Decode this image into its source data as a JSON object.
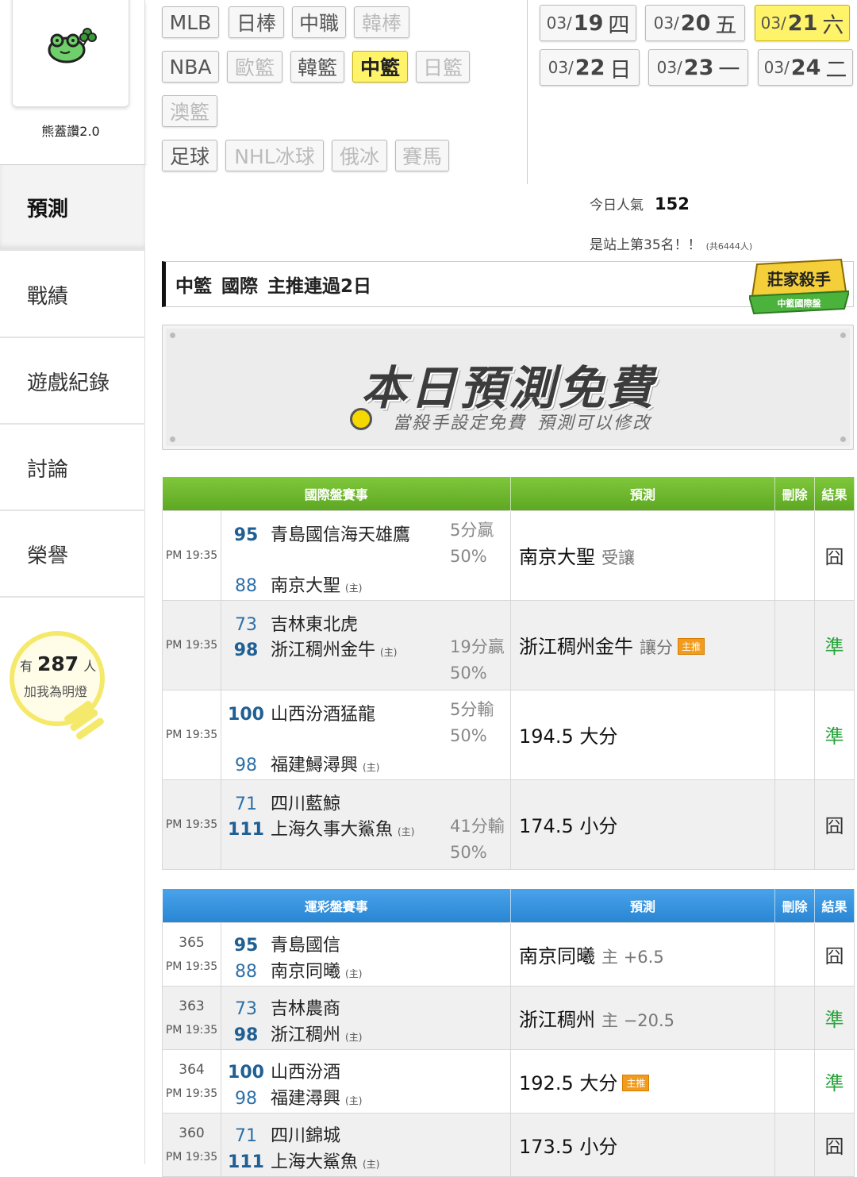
{
  "sidebar": {
    "nickname": "熊蓋讚2.0",
    "nav": [
      "預測",
      "戰績",
      "遊戲紀錄",
      "討論",
      "榮譽"
    ],
    "fans": {
      "prefix": "有",
      "count": "287",
      "suffix": "人",
      "caption": "加我為明燈"
    }
  },
  "leagues": {
    "row1": [
      "MLB",
      "日棒",
      "中職",
      "韓棒"
    ],
    "row2": [
      "NBA",
      "歐籃",
      "韓籃",
      "中籃",
      "日籃"
    ],
    "row3": [
      "澳籃"
    ],
    "row4": [
      "足球",
      "NHL冰球",
      "俄冰",
      "賽馬"
    ]
  },
  "dates": [
    {
      "md": "03/",
      "day": "19",
      "wd": "四"
    },
    {
      "md": "03/",
      "day": "20",
      "wd": "五"
    },
    {
      "md": "03/",
      "day": "21",
      "wd": "六"
    },
    {
      "md": "03/",
      "day": "22",
      "wd": "日"
    },
    {
      "md": "03/",
      "day": "23",
      "wd": "一"
    },
    {
      "md": "03/",
      "day": "24",
      "wd": "二"
    }
  ],
  "popularity": {
    "label": "今日人氣",
    "value": "152",
    "rank": "是站上第35名！！",
    "total": "(共6444人)"
  },
  "headline": {
    "league": "中籃",
    "board": "國際",
    "text": "主推連過2日"
  },
  "killer_badge": {
    "title": "莊家殺手",
    "sub": "中籃國際盤"
  },
  "banner": {
    "title": "本日預測免費",
    "sub1": "當殺手設定免費",
    "sub2": "預測可以修改"
  },
  "intl_table": {
    "headers": [
      "國際盤賽事",
      "預測",
      "刪除",
      "結果"
    ],
    "rows": [
      {
        "time": "PM 19:35",
        "away_score": "95",
        "away": "青島國信海天雄鷹",
        "home_score": "88",
        "home": "南京大聖",
        "home_tag": "(主)",
        "odds1": "5分贏",
        "odds2": "50%",
        "pick": "南京大聖",
        "pick_sub": "受讓",
        "result": "囧"
      },
      {
        "time": "PM 19:35",
        "away_score": "73",
        "away": "吉林東北虎",
        "home_score": "98",
        "home": "浙江稠州金牛",
        "home_tag": "(主)",
        "odds1": "19分贏",
        "odds2": "50%",
        "pick": "浙江稠州金牛",
        "pick_sub": "讓分",
        "pick_tag": "主推",
        "result": "準"
      },
      {
        "time": "PM 19:35",
        "away_score": "100",
        "away": "山西汾酒猛龍",
        "home_score": "98",
        "home": "福建鱘潯興",
        "home_tag": "(主)",
        "odds1": "5分輸",
        "odds2": "50%",
        "pick": "194.5 大分",
        "result": "準"
      },
      {
        "time": "PM 19:35",
        "away_score": "71",
        "away": "四川藍鯨",
        "home_score": "111",
        "home": "上海久事大鯊魚",
        "home_tag": "(主)",
        "odds1": "41分輸",
        "odds2": "50%",
        "pick": "174.5 小分",
        "result": "囧"
      }
    ]
  },
  "lottery_table": {
    "headers": [
      "運彩盤賽事",
      "預測",
      "刪除",
      "結果"
    ],
    "rows": [
      {
        "num": "365",
        "time": "PM 19:35",
        "away_score": "95",
        "away": "青島國信",
        "home_score": "88",
        "home": "南京同曦",
        "home_tag": "(主)",
        "pick": "南京同曦",
        "pick_sub": "主 +6.5",
        "result": "囧"
      },
      {
        "num": "363",
        "time": "PM 19:35",
        "away_score": "73",
        "away": "吉林農商",
        "home_score": "98",
        "home": "浙江稠州",
        "home_tag": "(主)",
        "pick": "浙江稠州",
        "pick_sub": "主 −20.5",
        "result": "準"
      },
      {
        "num": "364",
        "time": "PM 19:35",
        "away_score": "100",
        "away": "山西汾酒",
        "home_score": "98",
        "home": "福建潯興",
        "home_tag": "(主)",
        "pick": "192.5 大分",
        "pick_tag": "主推",
        "result": "準"
      },
      {
        "num": "360",
        "time": "PM 19:35",
        "away_score": "71",
        "away": "四川錦城",
        "home_score": "111",
        "home": "上海大鯊魚",
        "home_tag": "(主)",
        "pick": "173.5 小分",
        "result": "囧"
      }
    ]
  },
  "colors": {
    "accent_yellow": "#fff36a",
    "green_header": "#6ab82e",
    "blue_header": "#3795e0",
    "hit": "#2aa43d",
    "score": "#2d6fa8"
  }
}
